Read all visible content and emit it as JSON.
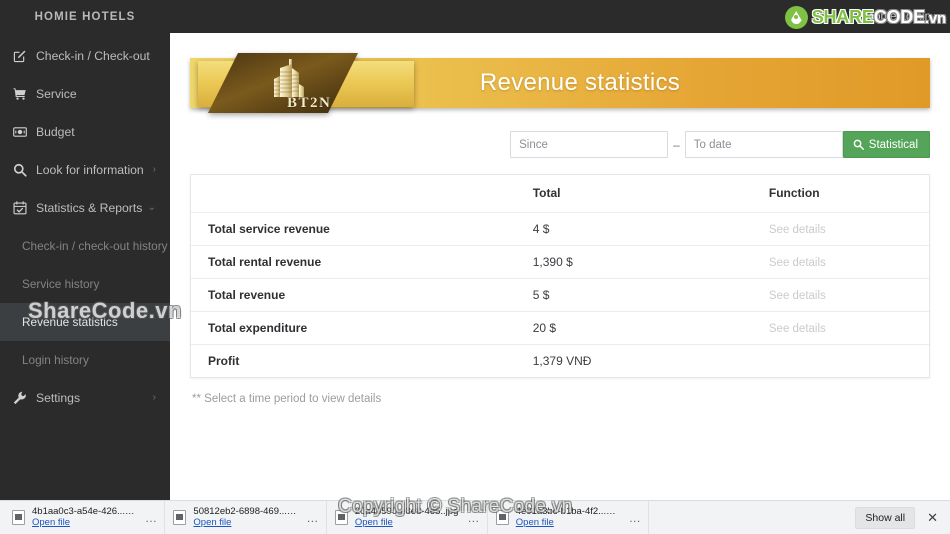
{
  "sidebar": {
    "brand": "HOMIE HOTELS",
    "items": [
      {
        "label": "Check-in / Check-out",
        "icon": "edit-square-icon",
        "chevron": ""
      },
      {
        "label": "Service",
        "icon": "cart-icon",
        "chevron": ""
      },
      {
        "label": "Budget",
        "icon": "money-icon",
        "chevron": ""
      },
      {
        "label": "Look for information",
        "icon": "search-icon",
        "chevron": "›"
      },
      {
        "label": "Statistics & Reports",
        "icon": "calendar-check-icon",
        "chevron": "⌄"
      }
    ],
    "subitems": [
      {
        "label": "Check-in / check-out history",
        "active": false
      },
      {
        "label": "Service history",
        "active": false
      },
      {
        "label": "Revenue statistics",
        "active": true
      },
      {
        "label": "Login history",
        "active": false
      }
    ],
    "settings": {
      "label": "Settings",
      "icon": "wrench-icon",
      "chevron": "›"
    }
  },
  "topbar": {
    "welcome": "Welcome admin",
    "caret": "▾"
  },
  "banner": {
    "title": "Revenue statistics",
    "logo_text": "BT2N"
  },
  "filter": {
    "since_placeholder": "Since",
    "since_value": "",
    "separator": "–",
    "todate_placeholder": "To date",
    "todate_value": "",
    "button_label": "Statistical",
    "button_color": "#54a559"
  },
  "table": {
    "headers": [
      "",
      "Total",
      "Function"
    ],
    "rows": [
      {
        "label": "Total service revenue",
        "total": "4 $",
        "func": "See details"
      },
      {
        "label": "Total rental revenue",
        "total": "1,390 $",
        "func": "See details"
      },
      {
        "label": "Total revenue",
        "total": "5 $",
        "func": "See details"
      },
      {
        "label": "Total expenditure",
        "total": "20 $",
        "func": "See details"
      },
      {
        "label": "Profit",
        "total": "1,379 VNĐ",
        "func": ""
      }
    ]
  },
  "note": "** Select a time period to view details",
  "watermarks": {
    "left": "ShareCode.vn",
    "center": "Copyright © ShareCode.vn",
    "logo_part1": "SHARE",
    "logo_part2": "CODE",
    "logo_part3": ".vn"
  },
  "downloads": {
    "files": [
      {
        "name": "4b1aa0c3-a54e-426...png",
        "action": "Open file",
        "menu": "…"
      },
      {
        "name": "50812eb2-6898-469....png",
        "action": "Open file",
        "menu": "…"
      },
      {
        "name": "20a48590-e8e8-4e5..jpg",
        "action": "Open file",
        "menu": "…"
      },
      {
        "name": "4e91a3bc-b1ba-4f2...png",
        "action": "Open file",
        "menu": "…"
      }
    ],
    "show_all": "Show all",
    "close": "✕"
  }
}
